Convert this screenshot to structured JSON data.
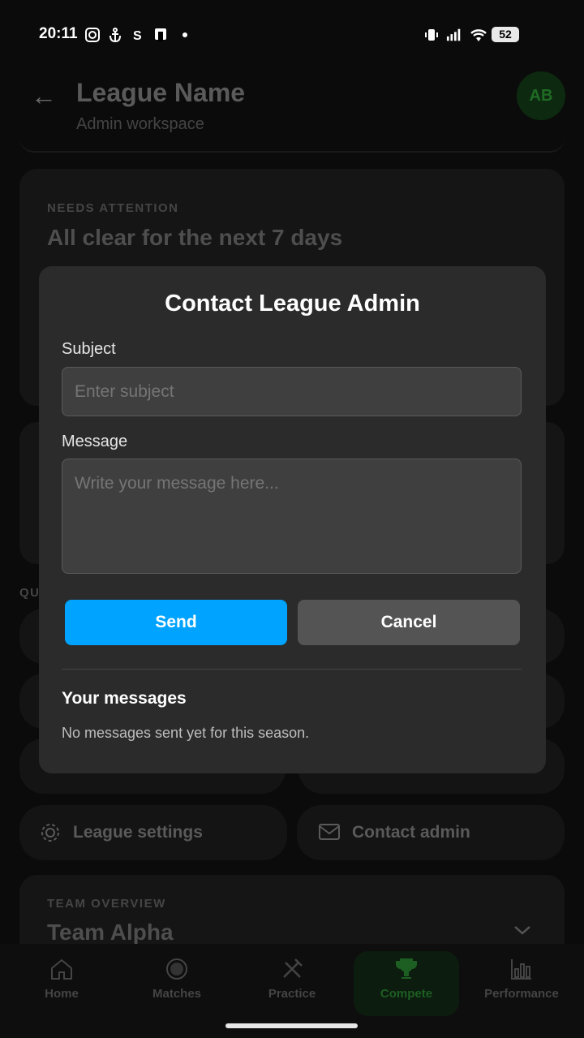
{
  "status_bar": {
    "time": "20:11",
    "battery": "52"
  },
  "header": {
    "title": "League Name",
    "subtitle": "Admin workspace",
    "avatar_initials": "AB"
  },
  "attention": {
    "label": "NEEDS ATTENTION",
    "text": "All clear for the next 7 days"
  },
  "quick_actions": {
    "label_fragment": "QU",
    "settings": "League settings",
    "contact": "Contact admin"
  },
  "team_overview": {
    "label": "TEAM OVERVIEW",
    "team": "Team Alpha"
  },
  "nav": {
    "items": [
      "Home",
      "Matches",
      "Practice",
      "Compete",
      "Performance"
    ],
    "active": "Compete"
  },
  "modal": {
    "title": "Contact League Admin",
    "subject_label": "Subject",
    "subject_placeholder": "Enter subject",
    "message_label": "Message",
    "message_placeholder": "Write your message here...",
    "send": "Send",
    "cancel": "Cancel",
    "messages_heading": "Your messages",
    "messages_empty": "No messages sent yet for this season."
  },
  "colors": {
    "accent": "#00a3ff",
    "compete": "#1d7a25",
    "cancel_bg": "#545454"
  }
}
